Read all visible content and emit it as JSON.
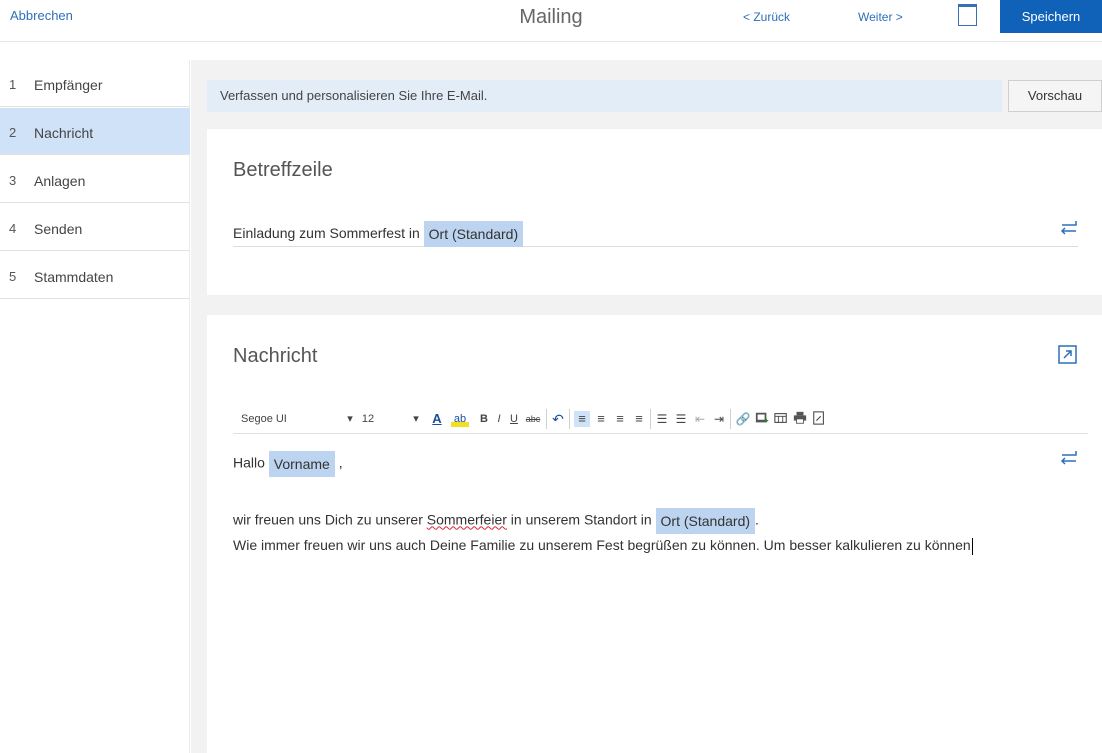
{
  "header": {
    "cancel_label": "Abbrechen",
    "title": "Mailing",
    "back_label": "< Zurück",
    "next_label": "Weiter >",
    "save_label": "Speichern",
    "icon": "document-icon"
  },
  "sidebar": {
    "items": [
      {
        "number": "1",
        "label": "Empfänger",
        "active": false
      },
      {
        "number": "2",
        "label": "Nachricht",
        "active": true
      },
      {
        "number": "3",
        "label": "Anlagen",
        "active": false
      },
      {
        "number": "4",
        "label": "Senden",
        "active": false
      },
      {
        "number": "5",
        "label": "Stammdaten",
        "active": false
      }
    ]
  },
  "main": {
    "info_text": "Verfassen und personalisieren Sie Ihre E-Mail.",
    "preview_label": "Vorschau"
  },
  "subject": {
    "heading": "Betreffzeile",
    "text": "Einladung zum Sommerfest in",
    "token": "Ort (Standard)"
  },
  "message": {
    "heading": "Nachricht",
    "toolbar": {
      "font": "Segoe UI",
      "size": "12",
      "arrow": "▾",
      "buttons": [
        "A",
        "ab",
        "B",
        "I",
        "U",
        "abc"
      ]
    },
    "greeting": "Hallo",
    "greeting_token": "Vorname",
    "greeting_punct": ",",
    "line1_prefix": "wir freuen uns Dich zu unserer",
    "line1_misspelled": "Sommerfeier",
    "line1_mid": "in unserem Standort in",
    "line1_token": "Ort (Standard)",
    "line1_suffix": ".",
    "line2": "Wie immer freuen wir uns auch Deine Familie zu unserem Fest begrüßen zu können. Um besser kalkulieren zu können"
  },
  "colors": {
    "accent": "#0f62b8",
    "link": "#2f6fba",
    "active_bg": "#cfe2f7",
    "token_bg": "#bcd4ef",
    "info_bg": "#e3edf8"
  }
}
